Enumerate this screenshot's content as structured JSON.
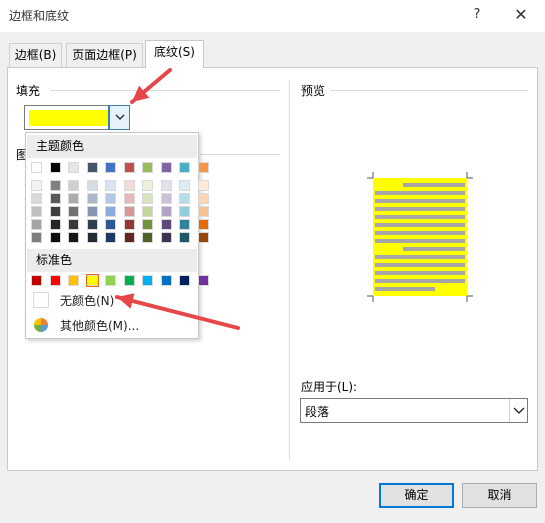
{
  "window": {
    "title": "边框和底纹",
    "help": "?",
    "close": "✕"
  },
  "tabs": [
    {
      "label": "边框(B)"
    },
    {
      "label": "页面边框(P)"
    },
    {
      "label": "底纹(S)"
    }
  ],
  "fill": {
    "label": "填充",
    "selected_color": "#ffff00"
  },
  "pattern": {
    "label": "图"
  },
  "colors_popup": {
    "theme_header": "主题颜色",
    "theme_top": [
      "#ffffff",
      "#000000",
      "#e7e6e6",
      "#44546a",
      "#4472c4",
      "#c0504d",
      "#9bbb59",
      "#8064a2",
      "#4bacc6",
      "#f79646"
    ],
    "theme_shades": [
      [
        "#f2f2f2",
        "#7f7f7f",
        "#d0cece",
        "#d6dce4",
        "#dae3f3",
        "#f2dcdb",
        "#ebf1dd",
        "#e5e0ec",
        "#dbeef3",
        "#fdeada"
      ],
      [
        "#d9d9d9",
        "#595959",
        "#aeabab",
        "#adb9ca",
        "#b4c7e7",
        "#e5b9b7",
        "#d7e3bc",
        "#ccc1d9",
        "#b7dde8",
        "#fbd5b5"
      ],
      [
        "#bfbfbf",
        "#3f3f3f",
        "#757070",
        "#8496b0",
        "#8faadc",
        "#d99694",
        "#c3d69b",
        "#b2a2c7",
        "#92cddc",
        "#fac08f"
      ],
      [
        "#a5a5a5",
        "#262626",
        "#3a3838",
        "#333f50",
        "#2f5597",
        "#953734",
        "#76923c",
        "#5f497a",
        "#31859b",
        "#e36c09"
      ],
      [
        "#7f7f7f",
        "#0c0c0c",
        "#171616",
        "#222a35",
        "#1f3864",
        "#632423",
        "#4f6128",
        "#3f3151",
        "#205867",
        "#974806"
      ]
    ],
    "standard_header": "标准色",
    "standard": [
      "#c00000",
      "#ff0000",
      "#ffc000",
      "#ffff00",
      "#92d050",
      "#00b050",
      "#00b0f0",
      "#0070c0",
      "#002060",
      "#7030a0"
    ],
    "no_color": "无颜色(N)",
    "more_colors": "其他颜色(M)..."
  },
  "preview": {
    "label": "预览",
    "fill_color": "#ffff00",
    "bar_color": "#a6a6a6"
  },
  "apply_to": {
    "label": "应用于(L):",
    "value": "段落"
  },
  "buttons": {
    "ok": "确定",
    "cancel": "取消"
  },
  "annotation_color": "#e8474a"
}
